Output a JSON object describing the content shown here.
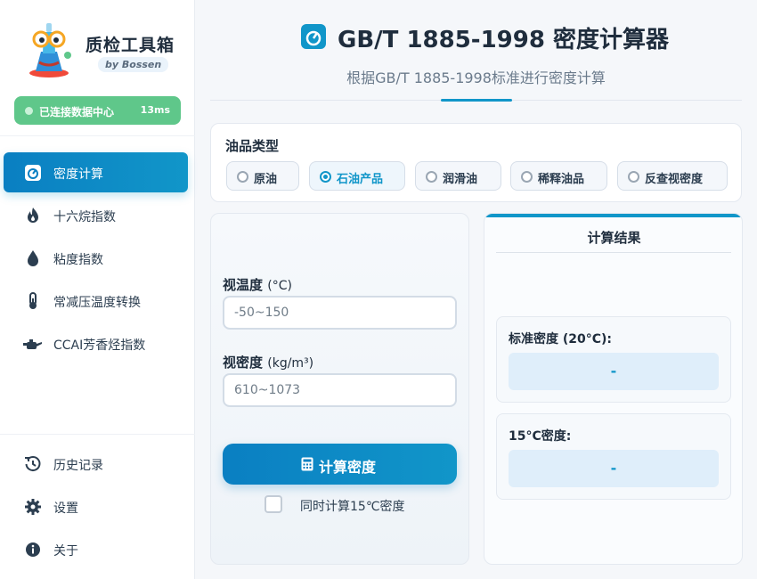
{
  "sidebar": {
    "brand_title": "质检工具箱",
    "brand_subtitle": "by Bossen",
    "status_text": "已连接数据中心",
    "status_latency": "13ms",
    "items": [
      {
        "label": "密度计算",
        "icon": "speedometer-icon",
        "active": true
      },
      {
        "label": "十六烷指数",
        "icon": "flame-icon",
        "active": false
      },
      {
        "label": "粘度指数",
        "icon": "droplet-icon",
        "active": false
      },
      {
        "label": "常减压温度转换",
        "icon": "thermometer-icon",
        "active": false
      },
      {
        "label": "CCAI芳香烃指数",
        "icon": "oil-can-icon",
        "active": false
      }
    ],
    "bottom_items": [
      {
        "label": "历史记录",
        "icon": "history-icon"
      },
      {
        "label": "设置",
        "icon": "gear-icon"
      },
      {
        "label": "关于",
        "icon": "info-icon"
      }
    ]
  },
  "header": {
    "title": "GB/T 1885-1998 密度计算器",
    "subtitle": "根据GB/T 1885-1998标准进行密度计算"
  },
  "oil_type": {
    "label": "油品类型",
    "options": [
      {
        "label": "原油",
        "selected": false
      },
      {
        "label": "石油产品",
        "selected": true
      },
      {
        "label": "润滑油",
        "selected": false
      },
      {
        "label": "稀释油品",
        "selected": false
      },
      {
        "label": "反查视密度",
        "selected": false
      }
    ]
  },
  "form": {
    "temp_label": "视温度",
    "temp_unit": "(°C)",
    "temp_placeholder": "-50~150",
    "density_label": "视密度",
    "density_unit": "(kg/m³)",
    "density_placeholder": "610~1073",
    "calc_button": "计算密度",
    "checkbox_label": "同时计算15℃密度",
    "checkbox_checked": false
  },
  "results": {
    "title": "计算结果",
    "standard_label": "标准密度 (20°C):",
    "standard_value": "-",
    "d15_label": "15°C密度:",
    "d15_value": "-"
  },
  "colors": {
    "accent": "#1196c9",
    "status_green": "#5fc78a"
  }
}
